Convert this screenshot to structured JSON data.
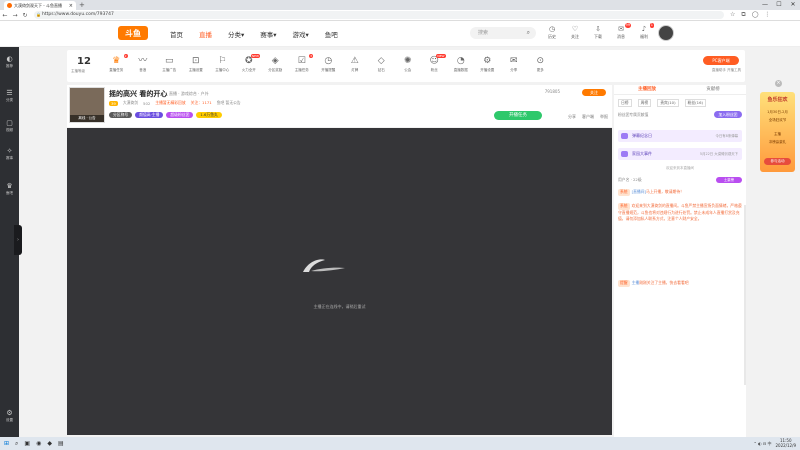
{
  "browser": {
    "tab_title": "大漠倚剑观天下 - 斗鱼直播",
    "tab_close": "×",
    "new_tab": "+",
    "url": "https://www.douyu.com/793747",
    "win_min": "—",
    "win_max": "☐",
    "win_close": "✕"
  },
  "topnav": {
    "logo": "斗鱼",
    "links": [
      "首页",
      "直播",
      "分类▾",
      "赛事▾",
      "游戏▾",
      "鱼吧"
    ],
    "search_placeholder": "搜索",
    "user_items": [
      {
        "label": "历史",
        "icon": "◷",
        "badge": ""
      },
      {
        "label": "关注",
        "icon": "♡",
        "badge": ""
      },
      {
        "label": "下载",
        "icon": "⇩",
        "badge": ""
      },
      {
        "label": "消息",
        "icon": "✉",
        "badge": "99"
      },
      {
        "label": "福利",
        "icon": "♪",
        "badge": "1"
      },
      {
        "label": "开播",
        "icon": "▭",
        "badge": ""
      }
    ]
  },
  "sidebar": {
    "items": [
      {
        "icon": "◐",
        "label": "推荐"
      },
      {
        "icon": "☰",
        "label": "分类"
      },
      {
        "icon": "▢",
        "label": "视频"
      },
      {
        "icon": "✧",
        "label": "赛事"
      },
      {
        "icon": "♛",
        "label": "鱼吧"
      },
      {
        "icon": "⚙",
        "label": "设置"
      }
    ],
    "collapse": "›"
  },
  "toolstrip": {
    "level": "12",
    "level_label": "主播等级",
    "tools": [
      {
        "label": "直播任务",
        "icon": "♛",
        "badge": "2"
      },
      {
        "label": "音浪",
        "icon": "〰",
        "badge": ""
      },
      {
        "label": "主播广告",
        "icon": "▭",
        "badge": ""
      },
      {
        "label": "主播设置",
        "icon": "⊡",
        "badge": ""
      },
      {
        "label": "主播中心",
        "icon": "⚐",
        "badge": ""
      },
      {
        "label": "火力全开",
        "icon": "✪",
        "badge": "NEW"
      },
      {
        "label": "分区奖励",
        "icon": "◈",
        "badge": ""
      },
      {
        "label": "主播任务",
        "icon": "☑",
        "badge": "3"
      },
      {
        "label": "开播提醒",
        "icon": "◷",
        "badge": ""
      },
      {
        "label": "灯牌",
        "icon": "⚠",
        "badge": ""
      },
      {
        "label": "钻石",
        "icon": "◇",
        "badge": ""
      },
      {
        "label": "公会",
        "icon": "✺",
        "badge": ""
      },
      {
        "label": "粉丝",
        "icon": "☺",
        "badge": "NEW"
      },
      {
        "label": "直播数据",
        "icon": "◔",
        "badge": ""
      },
      {
        "label": "开播设置",
        "icon": "⚙",
        "badge": ""
      },
      {
        "label": "分享",
        "icon": "✉",
        "badge": ""
      },
      {
        "label": "更多",
        "icon": "⊙",
        "badge": ""
      }
    ],
    "pc_button": "PC客户端",
    "pc_sub": "直播助手 开播工具"
  },
  "room": {
    "avatar_status": "离线 · 公告",
    "title": "摇的高兴 看的开心",
    "meta": "直播 · 游戏综合 · 户外",
    "level": "39",
    "anchor_name": "大漠倚剑",
    "extra1": "502",
    "extra2": "主播暂无精彩回放",
    "extra3": "关注：1171",
    "extra4": "鱼吧 暂无公告",
    "tags": [
      "分区称号",
      "颜值高·主播",
      "超级粉丝团",
      "1.6万鱼丸"
    ],
    "report": "791805",
    "follow": "关注",
    "task": "开播任务",
    "shares": [
      "分享",
      "客户端",
      "举报"
    ]
  },
  "video": {
    "status_text": "主播正在连线中，请稍后重试"
  },
  "chat": {
    "tabs": [
      "主播回放",
      "贡献榜"
    ],
    "subtabs": [
      "日榜",
      "周榜",
      "贵宾(10)",
      "粉丝(16)"
    ],
    "fans_text": "粉丝团专属贡献值",
    "fans_btn": "加入粉丝团",
    "cards": [
      {
        "title": "弹幕纪念日",
        "sub": "今日有8条弹幕"
      },
      {
        "title": "家园大事件",
        "sub": "5月22日 大漠倚剑观天下"
      }
    ],
    "welcome": "欢迎来到本直播间",
    "user_row": "用户名 · 22级",
    "user_badge": "土豪榜",
    "messages": [
      {
        "pre": "系统",
        "name": "[直播间]",
        "text": "马上开播，敬请期待！"
      },
      {
        "pre": "系统",
        "name": "",
        "text": "欢迎来到大漠倚剑的直播间。斗鱼严禁主播宣扬负面情绪，严格遵守直播规范，斗鱼也将对违规行为进行处罚。禁止未成年人直播打赏及充值，请勿添加私人联系方式，注意个人财产安全。"
      },
      {
        "pre": "提醒",
        "name": "主播",
        "text": "刚刚关注了主播，快去看看吧"
      }
    ]
  },
  "promo": {
    "title": "鱼乐狂欢",
    "line1": "1月30日-2月",
    "line2": "全场狂欢节",
    "line3": "主播",
    "line4": "冲榜赢豪礼",
    "button": "参与活动",
    "close": "×"
  },
  "taskbar": {
    "start": "⊞",
    "icons": [
      "⌕",
      "▣",
      "◉",
      "◆",
      "▤"
    ],
    "tray": "⌃ ◐ ⊟ 中",
    "time": "11:50",
    "date": "2022/12/9"
  }
}
